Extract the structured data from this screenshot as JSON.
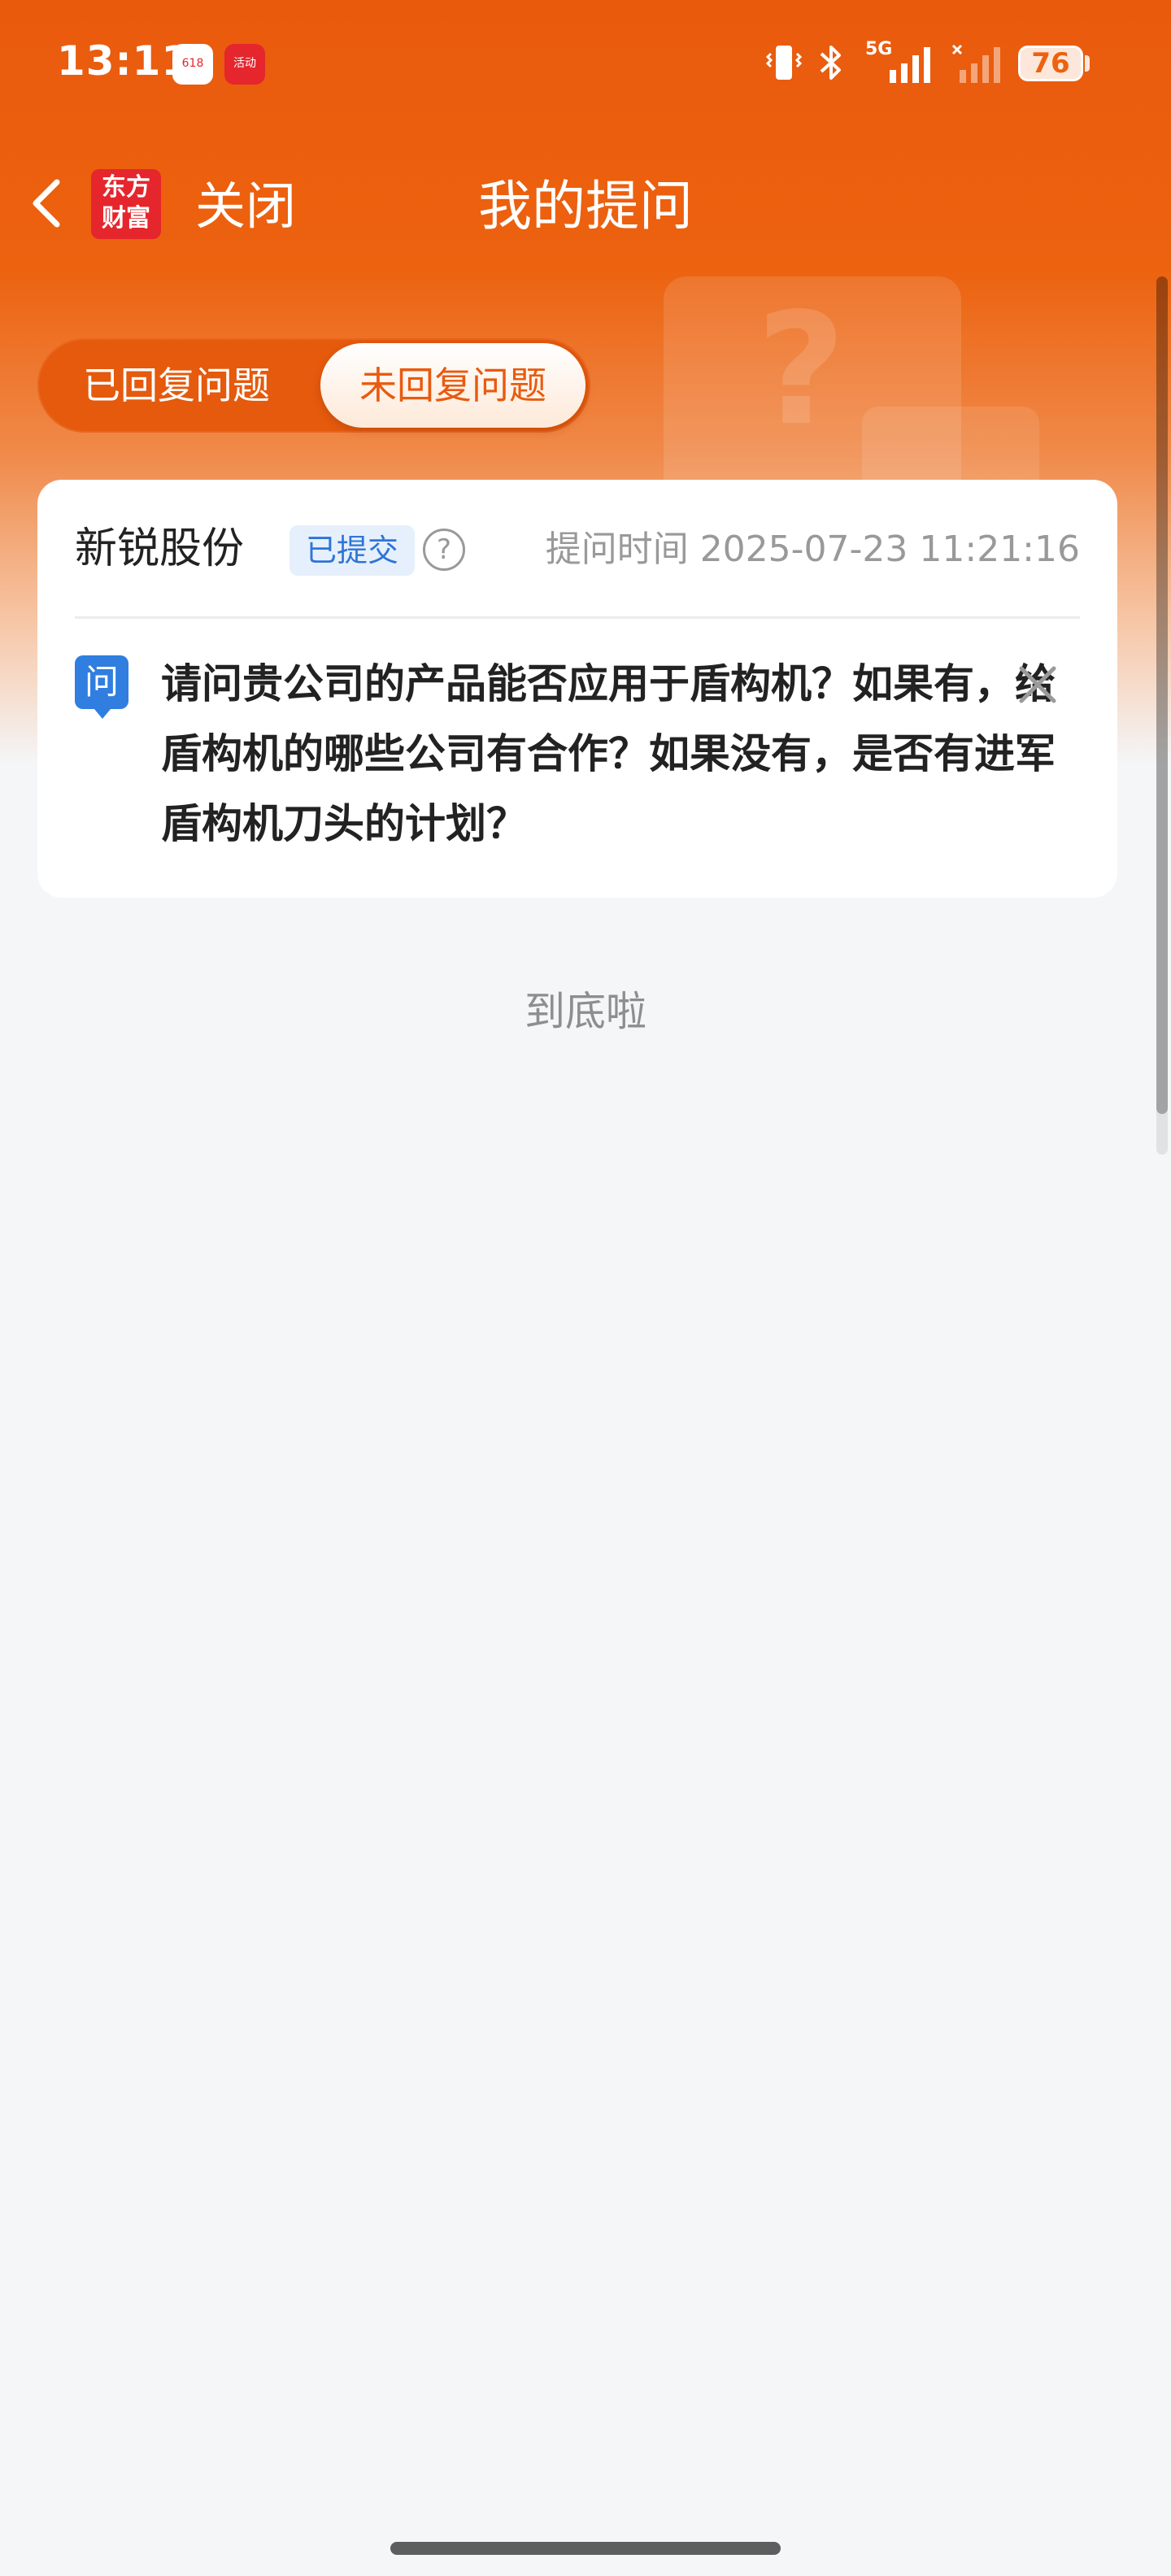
{
  "status_bar": {
    "time": "13:11",
    "network": "5G",
    "battery": "76",
    "app_badges": [
      "618",
      "活动"
    ],
    "icons": [
      "vibrate-icon",
      "bluetooth-icon",
      "signal-icon",
      "signal-no-sim-icon",
      "battery-icon"
    ]
  },
  "nav": {
    "back_icon": "chevron-left-icon",
    "logo_line1": "东方",
    "logo_line2": "财富",
    "close_label": "关闭",
    "title": "我的提问"
  },
  "tabs": [
    {
      "label": "已回复问题",
      "active": false
    },
    {
      "label": "未回复问题",
      "active": true
    }
  ],
  "question_card": {
    "company": "新锐股份",
    "status": "已提交",
    "help_icon": "question-circle-icon",
    "ask_time": "提问时间 2025-07-23 11:21:16",
    "q_icon_label": "问",
    "question_text": "请问贵公司的产品能否应用于盾构机？如果有，给盾构机的哪些公司有合作？如果没有，是否有进军盾构机刀头的计划？",
    "close_icon": "close-icon"
  },
  "footer": {
    "end_text": "到底啦"
  },
  "colors": {
    "brand_orange": "#ec620f",
    "tab_active_text": "#e95a0f",
    "badge_blue": "#2f75d6",
    "badge_bg": "#e6f0fc",
    "page_bg": "#f5f6f8"
  }
}
